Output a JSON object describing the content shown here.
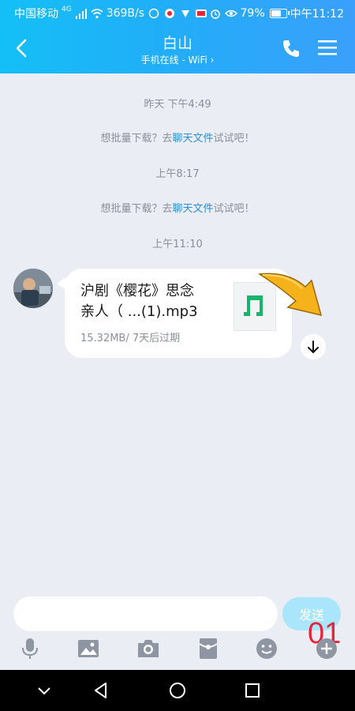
{
  "status_bar": {
    "carrier": "中国移动",
    "network_small": "4G",
    "speed": "369B/s",
    "battery_percent": "79%",
    "battery_level": 0.79,
    "time": "中午11:12"
  },
  "header": {
    "title": "白山",
    "subtitle": "手机在线 - WiFi",
    "subtitle_chevron": "›"
  },
  "chat": {
    "time_1": "昨天 下午4:49",
    "sys_1_prefix": "想批量下载？去",
    "sys_1_link": "聊天文件",
    "sys_1_suffix": "试试吧！",
    "time_2": "上午8:17",
    "sys_2_prefix": "想批量下载？去",
    "sys_2_link": "聊天文件",
    "sys_2_suffix": "试试吧！",
    "time_3": "上午11:10",
    "file": {
      "name_line1": "沪剧《樱花》思念",
      "name_line2": "亲人（ ...(1).mp3",
      "meta": "15.32MB/ 7天后过期",
      "icon": "music-note-icon"
    }
  },
  "input": {
    "placeholder": "",
    "value": "",
    "send_label": "发送",
    "overlay_number": "01"
  },
  "toolbar": [
    "microphone-icon",
    "image-icon",
    "camera-icon",
    "red-packet-icon",
    "emoji-icon",
    "plus-icon"
  ],
  "colors": {
    "header_start": "#14bff6",
    "header_end": "#3aa0fb",
    "link": "#2a8ed8",
    "music_green": "#19b36b",
    "overlay_red": "#e8243a"
  }
}
